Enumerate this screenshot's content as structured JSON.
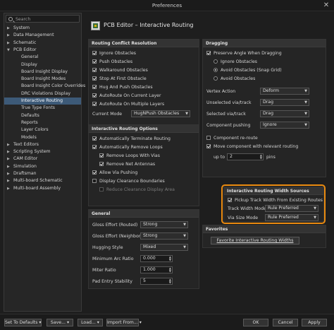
{
  "window": {
    "title": "Preferences",
    "close": "✕"
  },
  "search": {
    "placeholder": "Search"
  },
  "tree": [
    {
      "label": "System",
      "expanded": false,
      "depth": 0
    },
    {
      "label": "Data Management",
      "expanded": false,
      "depth": 0
    },
    {
      "label": "Schematic",
      "expanded": false,
      "depth": 0
    },
    {
      "label": "PCB Editor",
      "expanded": true,
      "depth": 0
    },
    {
      "label": "General",
      "depth": 1
    },
    {
      "label": "Display",
      "depth": 1
    },
    {
      "label": "Board Insight Display",
      "depth": 1
    },
    {
      "label": "Board Insight Modes",
      "depth": 1
    },
    {
      "label": "Board Insight Color Overrides",
      "depth": 1
    },
    {
      "label": "DRC Violations Display",
      "depth": 1
    },
    {
      "label": "Interactive Routing",
      "depth": 1,
      "selected": true
    },
    {
      "label": "True Type Fonts",
      "depth": 1
    },
    {
      "label": "Defaults",
      "depth": 1
    },
    {
      "label": "Reports",
      "depth": 1
    },
    {
      "label": "Layer Colors",
      "depth": 1
    },
    {
      "label": "Models",
      "depth": 1
    },
    {
      "label": "Text Editors",
      "expanded": false,
      "depth": 0
    },
    {
      "label": "Scripting System",
      "expanded": false,
      "depth": 0
    },
    {
      "label": "CAM Editor",
      "expanded": false,
      "depth": 0
    },
    {
      "label": "Simulation",
      "expanded": false,
      "depth": 0
    },
    {
      "label": "Draftsman",
      "expanded": false,
      "depth": 0
    },
    {
      "label": "Multi-board Schematic",
      "expanded": false,
      "depth": 0
    },
    {
      "label": "Multi-board Assembly",
      "expanded": false,
      "depth": 0
    }
  ],
  "page_title": "PCB Editor – Interactive Routing",
  "routing_conflict": {
    "header": "Routing Conflict Resolution",
    "options": [
      {
        "label": "Ignore Obstacles",
        "on": true
      },
      {
        "label": "Push Obstacles",
        "on": true
      },
      {
        "label": "Walkaround Obstacles",
        "on": true
      },
      {
        "label": "Stop At First Obstacle",
        "on": true
      },
      {
        "label": "Hug And Push Obstacles",
        "on": true
      },
      {
        "label": "AutoRoute On Current Layer",
        "on": true
      },
      {
        "label": "AutoRoute On Multiple Layers",
        "on": true
      }
    ],
    "current_mode_label": "Current Mode",
    "current_mode_value": "HugNPush Obstacles"
  },
  "routing_options": {
    "header": "Interactive Routing Options",
    "options": [
      {
        "label": "Automatically Terminate Routing",
        "on": true,
        "indent": false
      },
      {
        "label": "Automatically Remove Loops",
        "on": true,
        "indent": false
      },
      {
        "label": "Remove Loops With Vias",
        "on": true,
        "indent": true
      },
      {
        "label": "Remove Net Antennas",
        "on": true,
        "indent": true
      },
      {
        "label": "Allow Via Pushing",
        "on": true,
        "indent": false
      },
      {
        "label": "Display Clearance Boundaries",
        "on": false,
        "indent": false
      },
      {
        "label": "Reduce Clearance Display Area",
        "on": false,
        "indent": true,
        "disabled": true
      }
    ]
  },
  "general": {
    "header": "General",
    "rows": [
      {
        "label": "Gloss Effort (Routed)",
        "value": "Strong",
        "kind": "dropdown"
      },
      {
        "label": "Gloss Effort (Neighbor)",
        "value": "Strong",
        "kind": "dropdown"
      },
      {
        "label": "Hugging Style",
        "value": "Mixed",
        "kind": "dropdown"
      },
      {
        "label": "Minimum Arc Ratio",
        "value": "0.000",
        "kind": "spin"
      },
      {
        "label": "Miter Ratio",
        "value": "1.000",
        "kind": "spin"
      },
      {
        "label": "Pad Entry Stability",
        "value": "5",
        "kind": "spin"
      }
    ]
  },
  "dragging": {
    "header": "Dragging",
    "preserve_angle": "Preserve Angle When Dragging",
    "ignore_obstacles": "Ignore Obstacles",
    "avoid_obstacles": "Avoid Obstacles (Snap Grid)",
    "avoid_obstacles2": "Avoid Obstacles",
    "rows": [
      {
        "label": "Vertex Action",
        "value": "Deform"
      },
      {
        "label": "Unselected via/track",
        "value": "Drag"
      },
      {
        "label": "Selected via/track",
        "value": "Drag"
      },
      {
        "label": "Component pushing",
        "value": "Ignore"
      }
    ],
    "component_reroute": "Component re-route",
    "move_component": "Move component with relevant routing",
    "up_to": "up to",
    "up_to_value": "2",
    "pins": "pins"
  },
  "width_sources": {
    "header": "Interactive Routing Width Sources",
    "pickup": "Pickup Track Width From Existing Routes",
    "track_width_label": "Track Width Mode",
    "track_width_value": "Rule Preferred",
    "via_size_label": "Via Size Mode",
    "via_size_value": "Rule Preferred"
  },
  "favorites": {
    "header": "Favorites",
    "button": "Favorite Interactive Routing Widths"
  },
  "bottom": {
    "set_defaults": "Set To Defaults",
    "save": "Save...",
    "load": "Load...",
    "import": "Import From...",
    "ok": "OK",
    "cancel": "Cancel",
    "apply": "Apply"
  },
  "colors": {
    "highlight": "#e98a10",
    "selection": "#3d5a78"
  }
}
